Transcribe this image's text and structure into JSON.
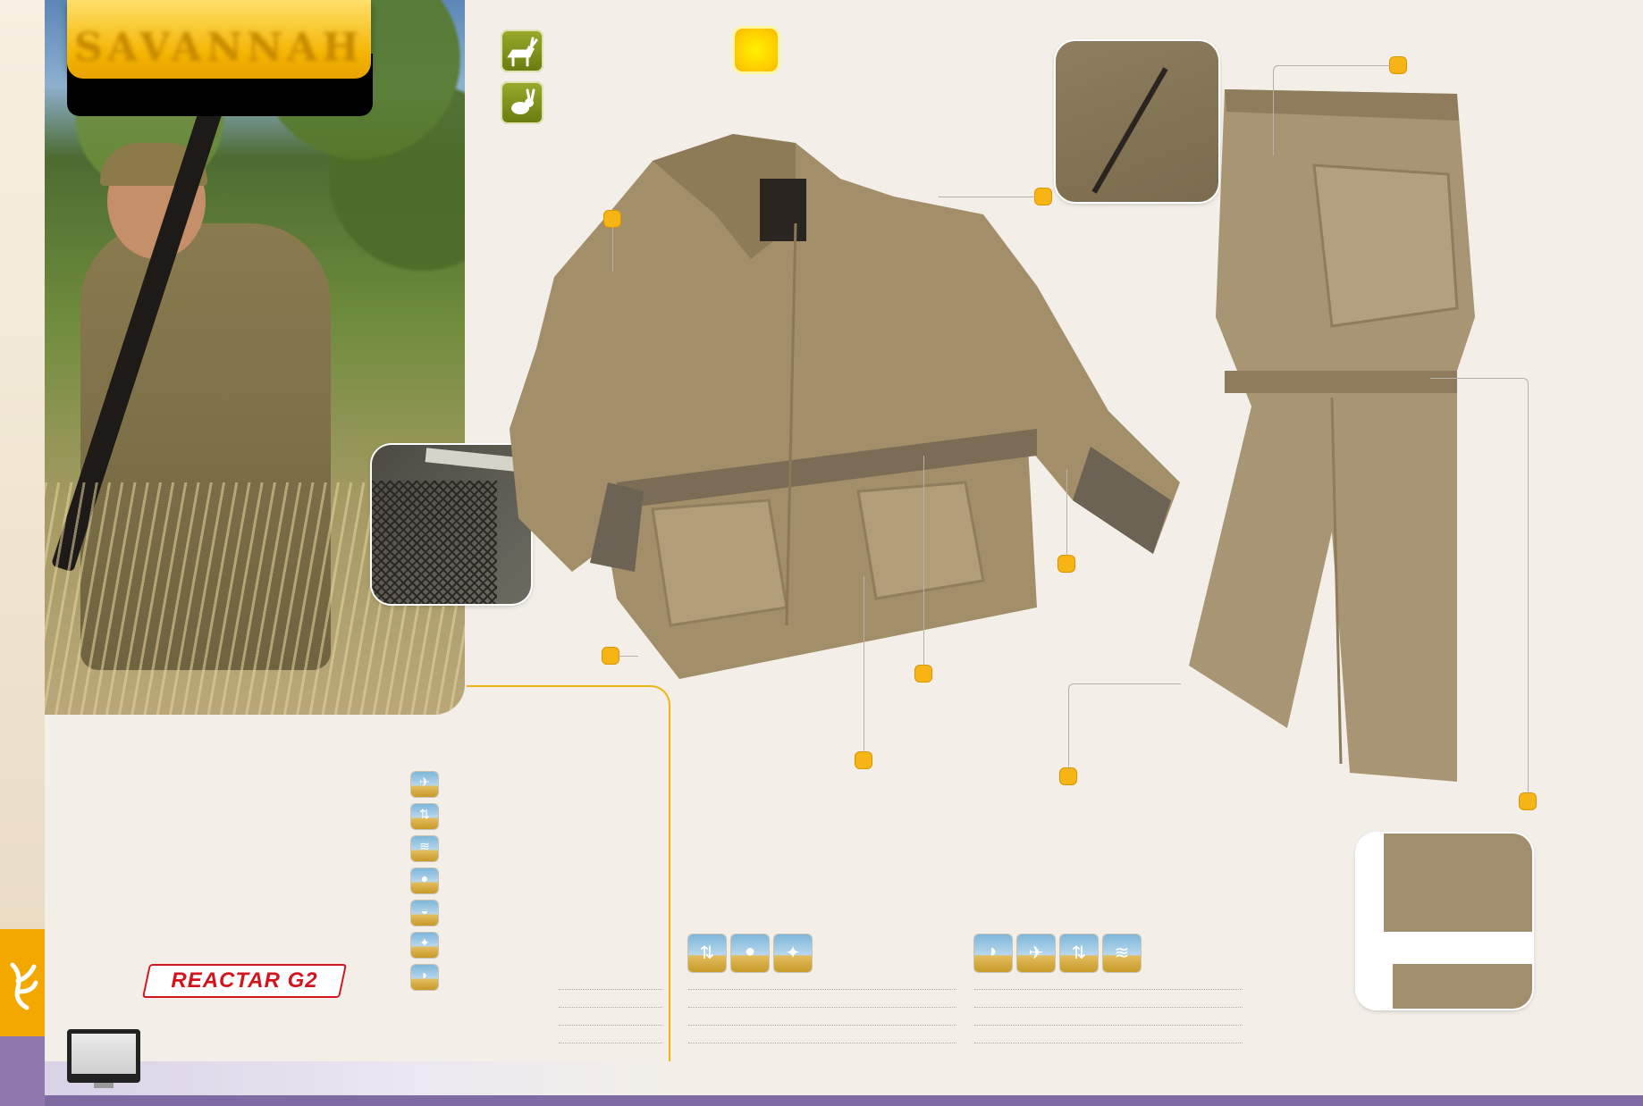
{
  "collection": {
    "title": "SAVANNAH"
  },
  "logos": {
    "reactar": "REACTAR G2",
    "brand_mark": "Buckmark"
  },
  "icons": {
    "game": [
      "deer-icon",
      "rabbit-icon"
    ],
    "season": "sun-icon",
    "left_features": [
      "feature-icon-1",
      "feature-icon-2",
      "feature-icon-3",
      "feature-icon-4",
      "feature-icon-5",
      "feature-icon-6",
      "feature-icon-7"
    ],
    "jacket_tech": [
      "tech-icon-1",
      "tech-icon-2",
      "tech-icon-3"
    ],
    "pants_tech": [
      "tech-icon-4",
      "tech-icon-5",
      "tech-icon-6",
      "tech-icon-7"
    ]
  },
  "colors": {
    "accent": "#f7b515",
    "game_badge": "#7a8a1c",
    "background": "#f3efe8",
    "footer_bar": "#7f6aa3",
    "reactar_red": "#d4141c"
  }
}
